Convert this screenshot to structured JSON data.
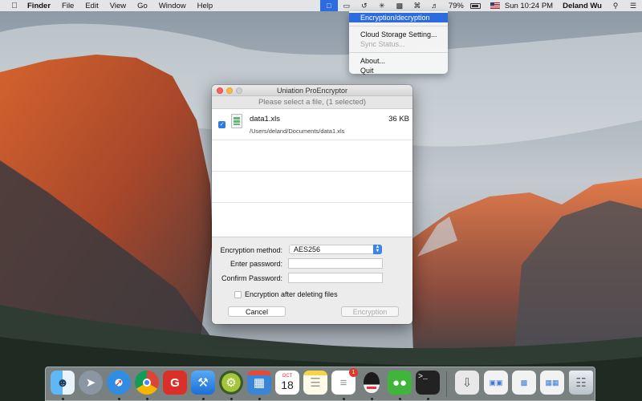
{
  "menubar": {
    "apple_icon": "apple-icon",
    "app_name": "Finder",
    "menus": [
      "File",
      "Edit",
      "View",
      "Go",
      "Window",
      "Help"
    ],
    "battery": "79%",
    "clock": "Sun 10:24 PM",
    "user": "Deland Wu"
  },
  "tray_menu": {
    "items": [
      {
        "label": "Encryption/decryption",
        "highlighted": true,
        "enabled": true
      },
      {
        "label": "Cloud Storage Setting...",
        "enabled": true
      },
      {
        "label": "Sync Status...",
        "enabled": false
      },
      {
        "label": "About...",
        "enabled": true
      },
      {
        "label": "Quit",
        "enabled": true
      }
    ]
  },
  "window": {
    "title": "Uniation ProEncryptor",
    "subtitle": "Please select a file, (1 selected)",
    "files": [
      {
        "name": "data1.xls",
        "path": "/Users/deland/Documents/data1.xls",
        "size": "36 KB",
        "checked": true
      }
    ],
    "form": {
      "method_label": "Encryption method:",
      "method_value": "AES256",
      "password_label": "Enter password:",
      "confirm_label": "Confirm Password:",
      "delete_after_label": "Encryption after deleting files",
      "cancel_label": "Cancel",
      "encrypt_label": "Encryption"
    }
  },
  "dock": {
    "items": [
      "finder",
      "launchpad",
      "safari",
      "chrome",
      "wps",
      "xcode",
      "android-studio",
      "photo-booth",
      "calendar",
      "notes",
      "reminders",
      "qq",
      "wechat",
      "terminal",
      "downloads",
      "documents",
      "screenshot",
      "preview",
      "trash"
    ],
    "calendar": {
      "month": "OCT",
      "day": "18"
    },
    "reminders_badge": "1"
  },
  "colors": {
    "accent": "#2d6cdf",
    "close": "#fc605c",
    "minimize": "#fdbc40"
  }
}
